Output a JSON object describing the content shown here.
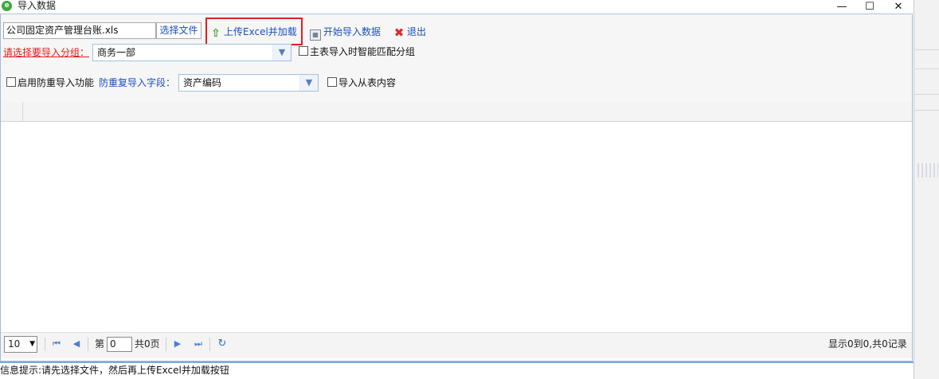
{
  "window": {
    "title": "导入数据",
    "icon": "app-e-icon",
    "minimize_glyph": "—",
    "maximize_glyph": "☐",
    "close_glyph": "✕"
  },
  "toolbar": {
    "file_value": "公司固定资产管理台账.xls",
    "select_file_label": "选择文件",
    "upload_label": "上传Excel并加载",
    "start_import_label": "开始导入数据",
    "exit_label": "退出"
  },
  "group": {
    "label": "请选择要导入分组：",
    "selected": "商务一部",
    "smart_match_label": "主表导入时智能匹配分组"
  },
  "dedupe": {
    "enable_label": "启用防重导入功能",
    "field_label": "防重复导入字段：",
    "field_selected": "资产编码",
    "import_from_sub_label": "导入从表内容"
  },
  "pager": {
    "page_size": "10",
    "page_prefix": "第",
    "page_value": "0",
    "page_suffix": "共0页",
    "summary": "显示0到0,共0记录"
  },
  "status": {
    "message": "信息提示:请先选择文件，然后再上传Excel并加载按钮"
  },
  "colors": {
    "link_blue": "#1a4fbf",
    "highlight_red": "#e02020",
    "label_red": "#e21b1b",
    "border_blue": "#9dbbe0"
  }
}
